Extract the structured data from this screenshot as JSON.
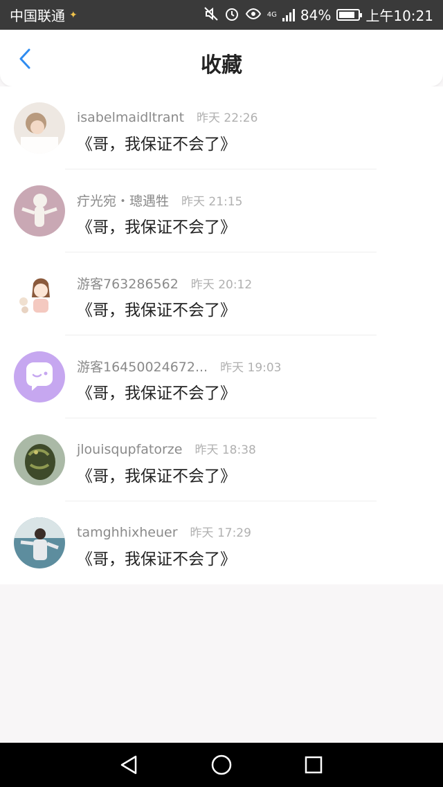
{
  "status_bar": {
    "carrier": "中国联通",
    "network": "4G",
    "battery": "84%",
    "battery_level": 0.84,
    "time": "上午10:21"
  },
  "header": {
    "title": "收藏",
    "back_icon": "chevron-left-icon"
  },
  "colors": {
    "accent": "#2f8cf0",
    "background": "#f8f6f7"
  },
  "items": [
    {
      "username": "isabelmaidltrant",
      "time": "昨天 22:26",
      "title": "《哥，我保证不会了》"
    },
    {
      "username": "疔光宛・璁遇牲",
      "time": "昨天 21:15",
      "title": "《哥，我保证不会了》"
    },
    {
      "username": "游客763286562",
      "time": "昨天 20:12",
      "title": "《哥，我保证不会了》"
    },
    {
      "username": "游客16450024672...",
      "time": "昨天 19:03",
      "title": "《哥，我保证不会了》"
    },
    {
      "username": "jlouisqupfatorze",
      "time": "昨天 18:38",
      "title": "《哥，我保证不会了》"
    },
    {
      "username": "tamghhixheuer",
      "time": "昨天 17:29",
      "title": "《哥，我保证不会了》"
    }
  ],
  "nav_bar": {
    "back": "triangle-back-icon",
    "home": "circle-home-icon",
    "recents": "square-recents-icon"
  }
}
